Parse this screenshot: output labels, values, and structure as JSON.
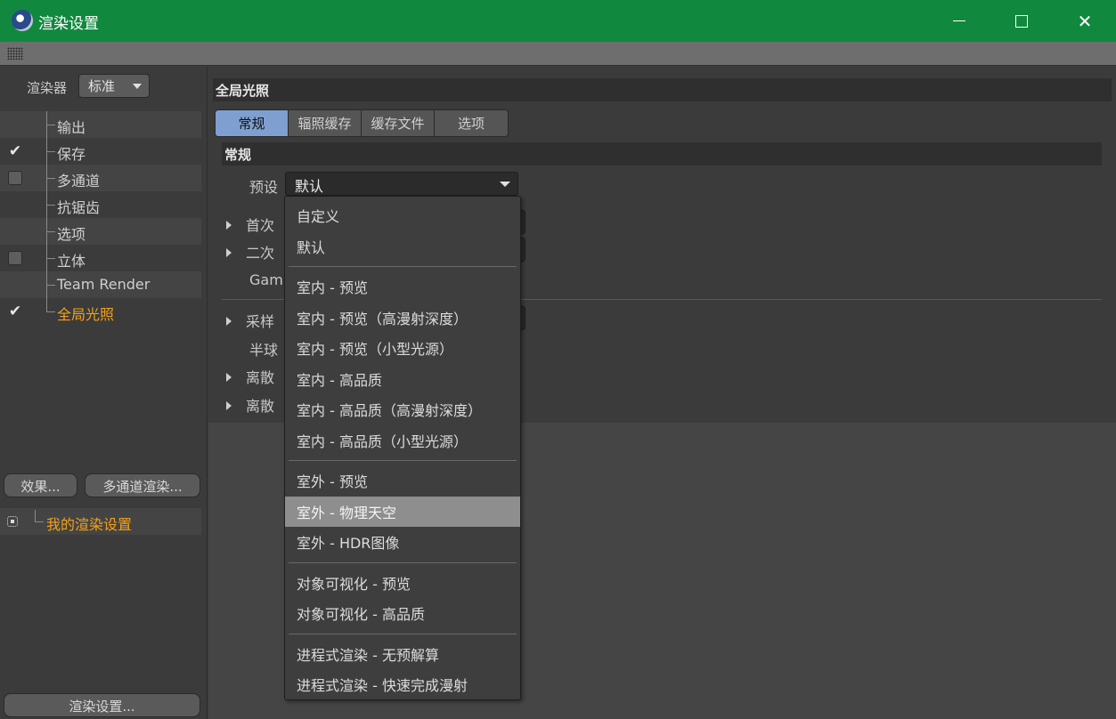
{
  "window": {
    "title": "渲染设置",
    "icon": "cinema4d-app-icon",
    "controls": [
      "minimize",
      "maximize",
      "close"
    ]
  },
  "left": {
    "renderer_label": "渲染器",
    "renderer_value": "标准",
    "tree": [
      {
        "label": "输出",
        "check": "none",
        "active": false
      },
      {
        "label": "保存",
        "check": "tick",
        "active": false
      },
      {
        "label": "多通道",
        "check": "box",
        "active": false
      },
      {
        "label": "抗锯齿",
        "check": "none",
        "active": false
      },
      {
        "label": "选项",
        "check": "none",
        "active": false
      },
      {
        "label": "立体",
        "check": "box",
        "active": false
      },
      {
        "label": "Team Render",
        "check": "none",
        "active": false
      },
      {
        "label": "全局光照",
        "check": "tick",
        "active": true
      }
    ],
    "effects_button": "效果...",
    "multipass_button": "多通道渲染...",
    "settings_item": "我的渲染设置",
    "render_settings_button": "渲染设置..."
  },
  "right": {
    "header": "全局光照",
    "tabs": [
      "常规",
      "辐照缓存",
      "缓存文件",
      "选项"
    ],
    "active_tab": 0,
    "section": "常规",
    "preset_label": "预设",
    "preset_value": "默认",
    "props": [
      "首次",
      "二次",
      "Gamm",
      "采样",
      "半球",
      "离散",
      "离散"
    ]
  },
  "dropdown": {
    "groups": [
      [
        "自定义",
        "默认"
      ],
      [
        "室内 - 预览",
        "室内 - 预览（高漫射深度）",
        "室内 - 预览（小型光源）",
        "室内 - 高品质",
        "室内 - 高品质（高漫射深度）",
        "室内 - 高品质（小型光源）"
      ],
      [
        "室外 - 预览",
        "室外 - 物理天空",
        "室外 - HDR图像"
      ],
      [
        "对象可视化 - 预览",
        "对象可视化 - 高品质"
      ],
      [
        "进程式渲染 - 无预解算",
        "进程式渲染 - 快速完成漫射"
      ]
    ],
    "highlighted": "室外 - 物理天空"
  },
  "colors": {
    "titlebar": "#10893e",
    "active_tab": "#7f9fd0",
    "active_item": "#f2a11c"
  }
}
